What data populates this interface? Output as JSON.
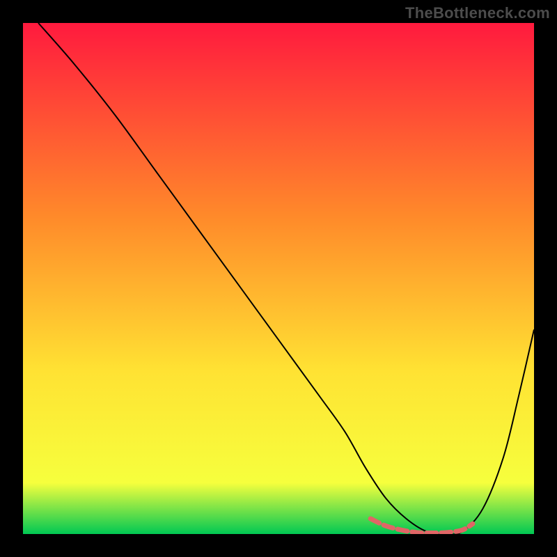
{
  "watermark": "TheBottleneck.com",
  "chart_data": {
    "type": "line",
    "title": "",
    "xlabel": "",
    "ylabel": "",
    "xlim": [
      0,
      100
    ],
    "ylim": [
      0,
      100
    ],
    "grid": false,
    "gradient": {
      "top": "#ff1a3e",
      "mid_upper": "#ff8a2a",
      "mid": "#ffe233",
      "mid_lower": "#f6ff3d",
      "bottom": "#00c853"
    },
    "series": [
      {
        "name": "main-curve",
        "color": "#000000",
        "stroke_width": 2,
        "x": [
          3,
          10,
          18,
          26,
          34,
          42,
          50,
          58,
          63,
          67,
          71,
          75,
          79,
          83,
          86,
          90,
          94,
          97,
          100
        ],
        "values": [
          100,
          92,
          82,
          71,
          60,
          49,
          38,
          27,
          20,
          13,
          7,
          3,
          0.5,
          0,
          0.5,
          5,
          15,
          27,
          40
        ]
      },
      {
        "name": "highlight-segment",
        "color": "#e06666",
        "stroke_width": 7,
        "dash": "14 7",
        "x": [
          68,
          71,
          74,
          77,
          80,
          83,
          86,
          88
        ],
        "values": [
          3,
          1.6,
          0.8,
          0.3,
          0.2,
          0.3,
          0.8,
          2
        ]
      }
    ]
  }
}
